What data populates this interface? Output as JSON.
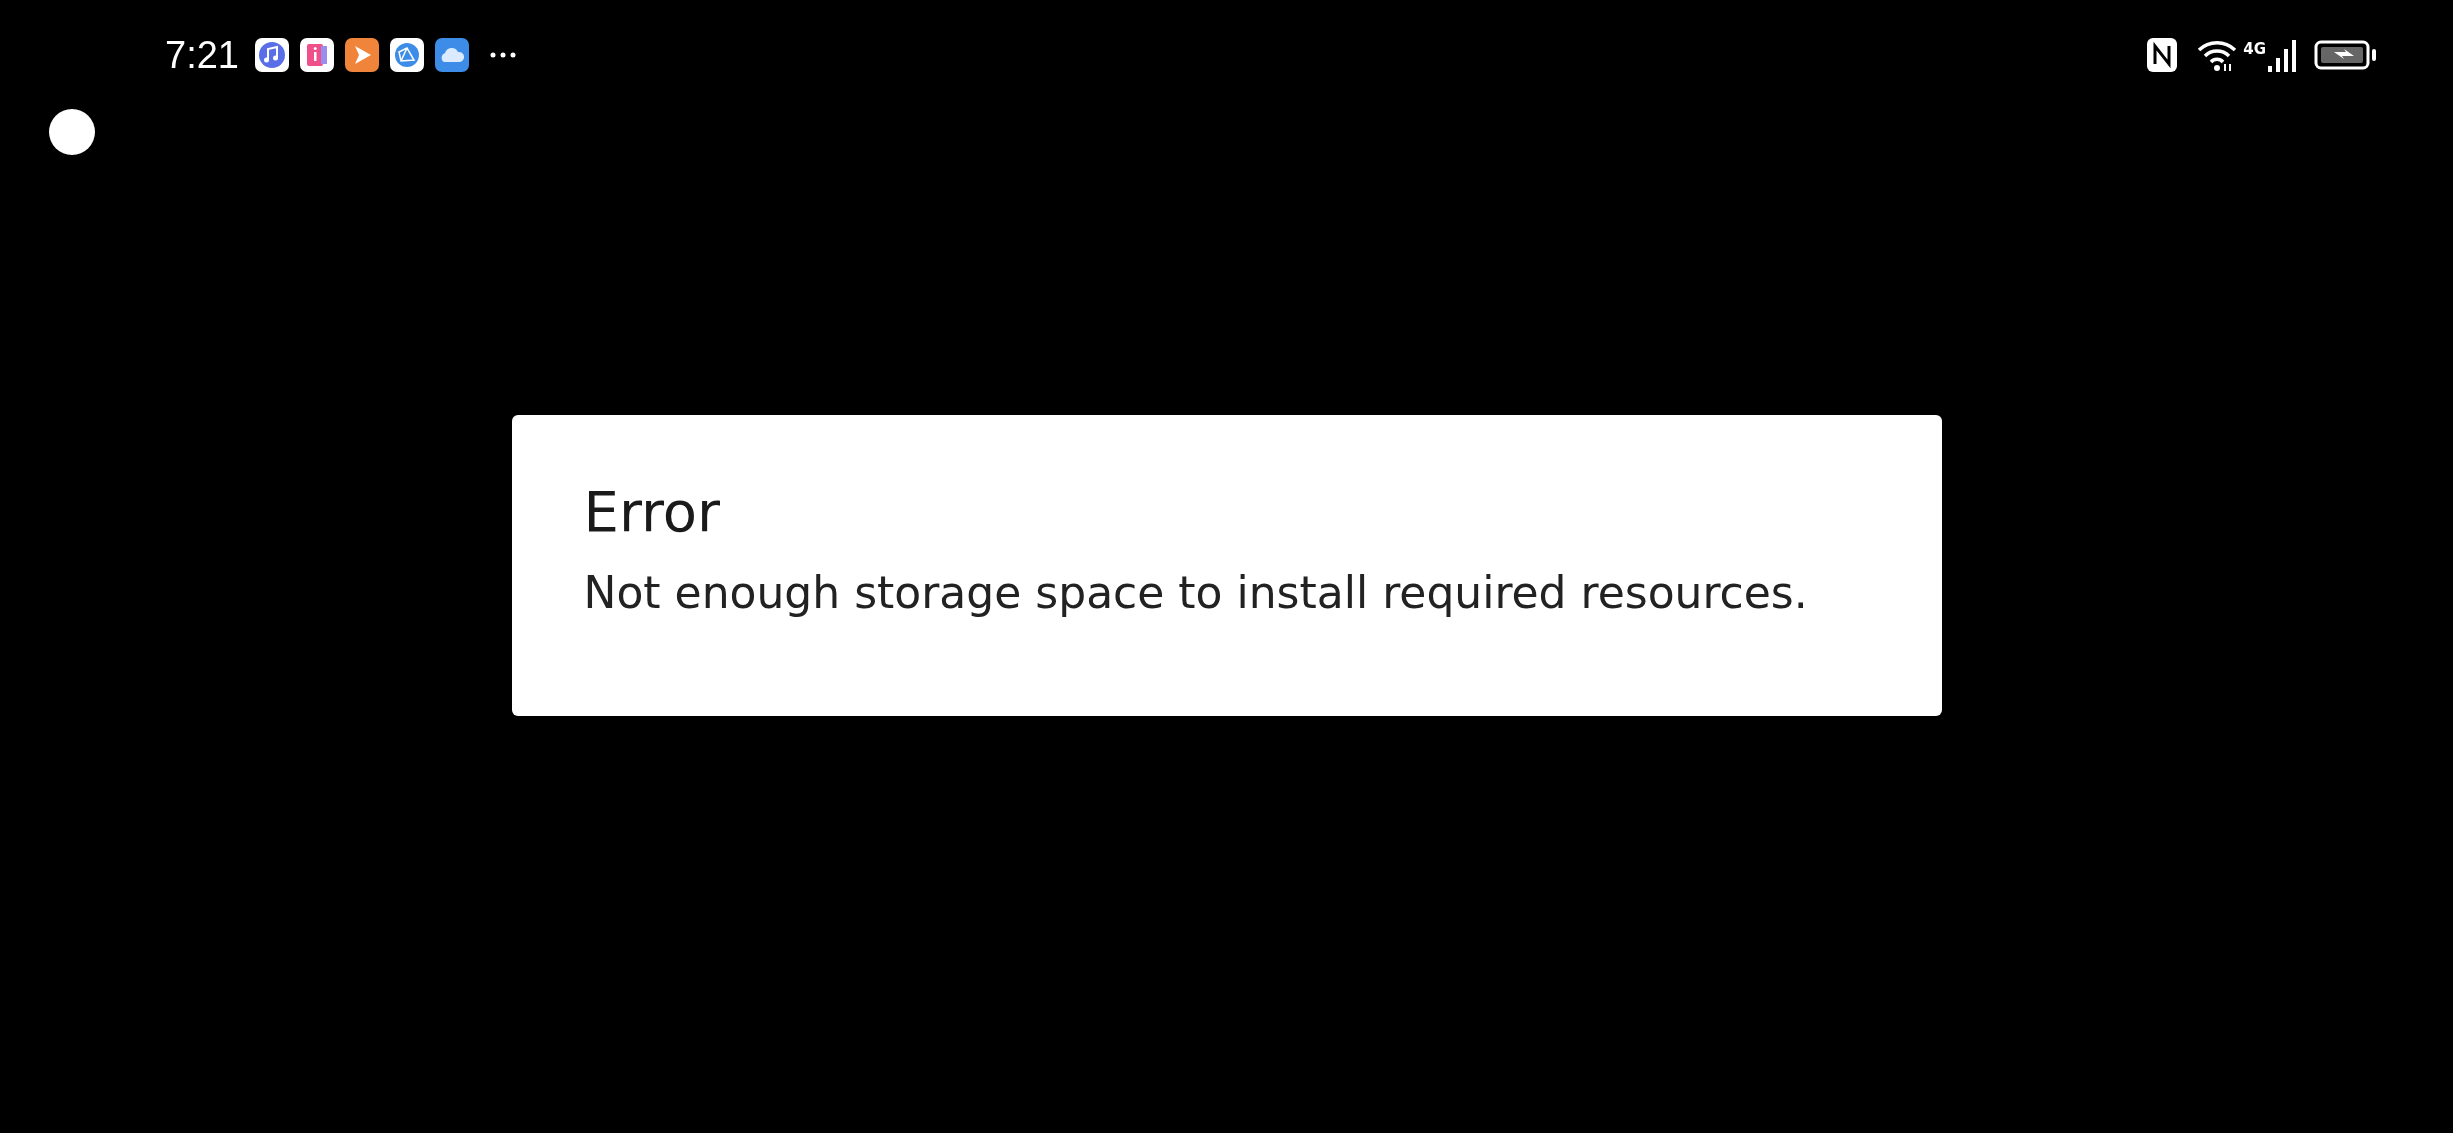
{
  "status_bar": {
    "time": "7:21",
    "network": "4G"
  },
  "dialog": {
    "title": "Error",
    "message": "Not enough storage space to install required resources."
  }
}
